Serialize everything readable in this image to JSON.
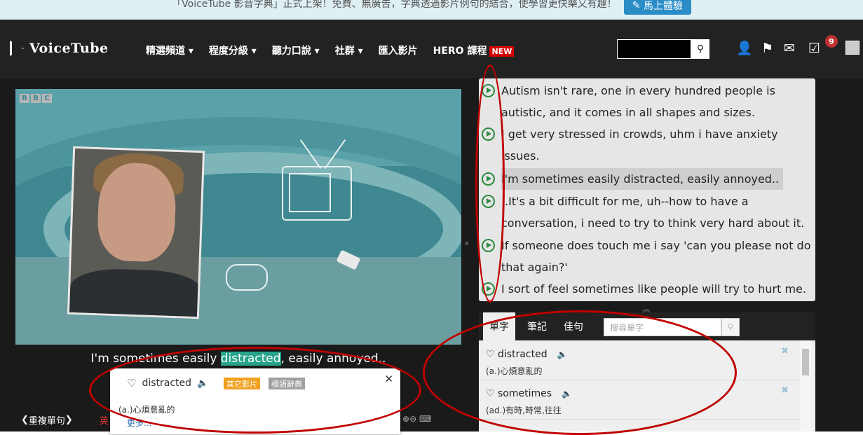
{
  "banner": {
    "text": "「VoiceTube 影音字典」正式上架！免費、無廣告，字典透過影片例句的結合，使學習更快樂又有趣！",
    "button": "馬上體驗"
  },
  "nav": {
    "logo": "VoiceTube",
    "items": [
      "精選頻道 ▾",
      "程度分級 ▾",
      "聽力口說 ▾",
      "社群 ▾",
      "匯入影片",
      "HERO 課程"
    ],
    "new_badge": "NEW",
    "notification_count": "9"
  },
  "video": {
    "channel_logo": [
      "B",
      "B",
      "C"
    ],
    "subtitle_before": "I'm sometimes easily ",
    "subtitle_highlight": "distracted",
    "subtitle_after": ", easily annoyed..",
    "repeat_label": "重複單句",
    "red_letter": "英"
  },
  "popup": {
    "word": "distracted",
    "tag_other_videos": "其它影片",
    "tag_dictionary": "標語辭典",
    "definition": "(a.)心煩意亂的",
    "more": "更多..."
  },
  "transcript": {
    "lines": [
      "Autism isn't rare, one in every hundred people is",
      "autistic, and it comes in all shapes and sizes.",
      "I get very stressed in crowds, uhm i have anxiety",
      "issues.",
      "I'm sometimes easily distracted, easily annoyed..",
      "..It's a bit difficult for me, uh--how to have a",
      "conversation, i need to try to think very hard about it.",
      "If someone does touch me i say 'can you please not do",
      "that again?'",
      "I sort of feel sometimes like people will try to hurt me."
    ]
  },
  "word_panel": {
    "tabs": [
      "單字",
      "筆記",
      "佳句"
    ],
    "search_placeholder": "搜尋單字",
    "words": [
      {
        "word": "distracted",
        "definition": "(a.)心煩意亂的"
      },
      {
        "word": "sometimes",
        "definition": "(ad.)有時,時常,往往"
      }
    ]
  },
  "colors": {
    "navbar": "#222222",
    "highlight": "#27a38a",
    "annotation": "#c00000",
    "play_icon": "#2b8a3e"
  }
}
